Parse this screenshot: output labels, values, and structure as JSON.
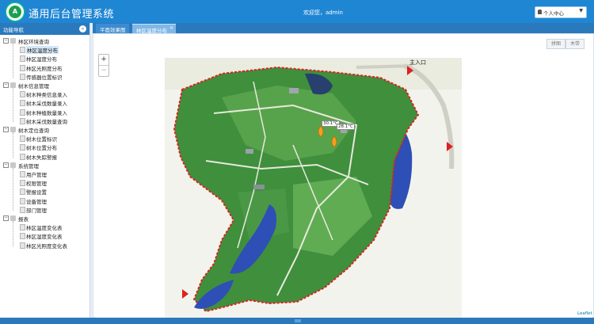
{
  "header": {
    "logo_text": "A",
    "title": "通用后台管理系统",
    "welcome": "欢迎您，admin",
    "user_menu_label": "个人中心",
    "user_menu_caret": "▼"
  },
  "sidebar": {
    "title": "功能导航",
    "collapse_icon": "«",
    "groups": [
      {
        "label": "林区环境查询",
        "items": [
          "林区温度分布",
          "林区湿度分布",
          "林区光照度分布",
          "传感器位置标识"
        ]
      },
      {
        "label": "树木信息管理",
        "items": [
          "树木种类信息录入",
          "树木采伐数量录入",
          "树木种植数量录入",
          "树木采伐数量查询"
        ]
      },
      {
        "label": "树木定位查询",
        "items": [
          "树木位置标识",
          "树木位置分布",
          "树木失踪警报"
        ]
      },
      {
        "label": "系统管理",
        "items": [
          "用户管理",
          "权限管理",
          "警报设置",
          "设备管理",
          "部门管理"
        ]
      },
      {
        "label": "报表",
        "items": [
          "林区温度变化表",
          "林区湿度变化表",
          "林区光照度变化表"
        ]
      }
    ]
  },
  "tabs": [
    {
      "label": "平面效果图",
      "close": ""
    },
    {
      "label": "林区温度分布",
      "close": "×"
    }
  ],
  "toolbar": {
    "btn_left": "拼图",
    "btn_right": "木带"
  },
  "map": {
    "zoom_in": "+",
    "zoom_out": "−",
    "entrance_label": "主入口",
    "sensor_values": [
      "30.1°C",
      "28.1°C"
    ],
    "attribution": "Leaflet",
    "colors": {
      "water": "#2e4fb5",
      "forest": "#3f8f3c",
      "path": "#e7e9dc",
      "border": "#e02020"
    }
  }
}
